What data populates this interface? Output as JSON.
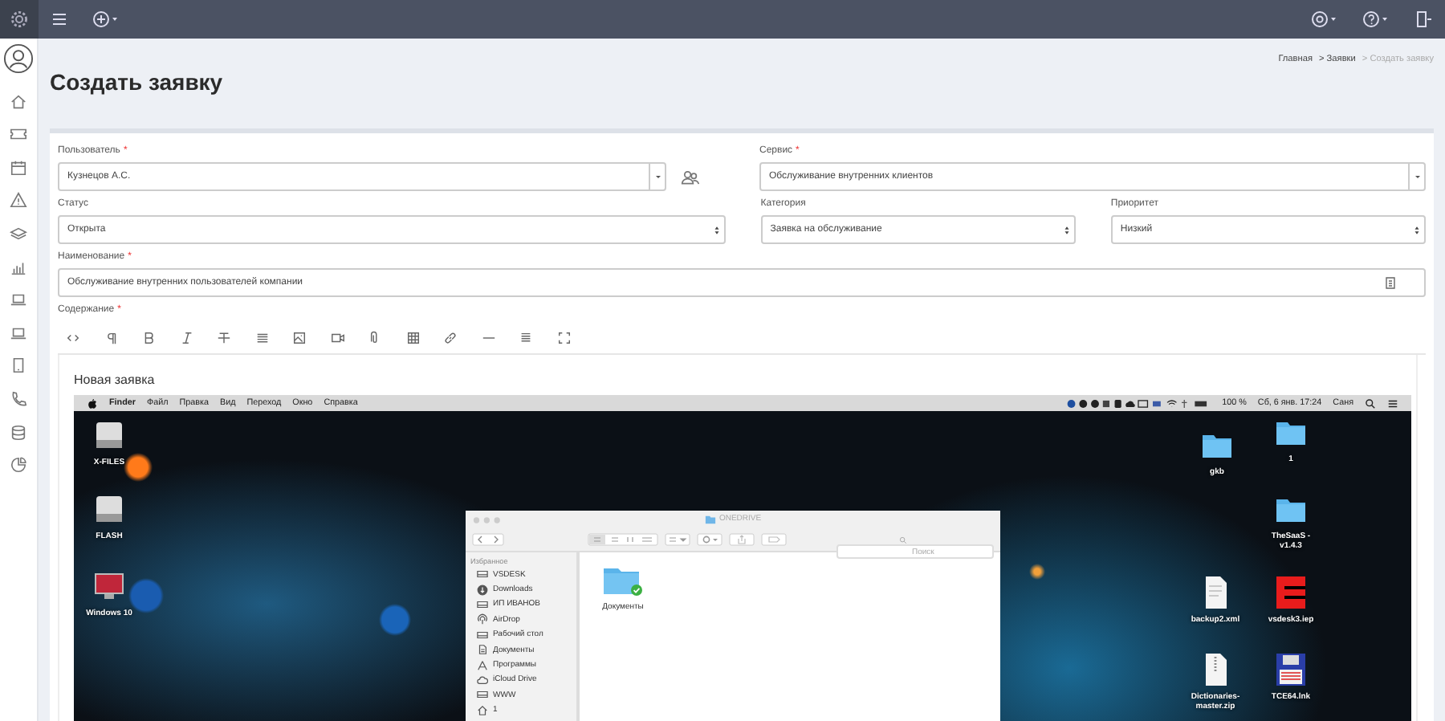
{
  "page_title": "Создать заявку",
  "breadcrumb": [
    {
      "label": "Главная",
      "current": false
    },
    {
      "label": "> Заявки",
      "current": false
    },
    {
      "label": "> Создать заявку",
      "current": true
    }
  ],
  "form_rows": [
    [
      {
        "label": "Пользователь",
        "required_mark": "*",
        "value": "Кузнецов А.С.",
        "kind": "combo",
        "user_picker": true
      },
      {
        "label": "Сервис",
        "required_mark": "*",
        "value": "Обслуживание внутренних клиентов",
        "kind": "combo"
      }
    ],
    [
      {
        "label": "Статус",
        "value": "Открыта",
        "kind": "select"
      },
      {
        "label": "Категория",
        "value": "Заявка на обслуживание",
        "kind": "select"
      },
      {
        "label": "Приоритет",
        "value": "Низкий",
        "kind": "select"
      }
    ],
    [
      {
        "label": "Наименование",
        "required_mark": "*",
        "value": "Обслуживание внутренних пользователей компании",
        "kind": "text"
      }
    ]
  ],
  "editor": {
    "label": "Содержание",
    "required_mark": "*",
    "heading": "Новая заявка",
    "screenshot": {
      "menu_bar": {
        "app": "Finder",
        "menus": [
          "Файл",
          "Правка",
          "Вид",
          "Переход",
          "Окно",
          "Справка"
        ],
        "battery": "100 %",
        "clock": "Сб, 6 янв. 17:24",
        "user": "Саня"
      },
      "desktop_icons": [
        {
          "label": "X-FILES",
          "kind": "drive"
        },
        {
          "label": "FLASH",
          "kind": "drive"
        },
        {
          "label": "Windows 10",
          "kind": "monitor"
        },
        {
          "label": "gkb",
          "kind": "folder"
        },
        {
          "label": "1",
          "kind": "folder"
        },
        {
          "label": "TheSaaS - v1.4.3",
          "kind": "folder"
        },
        {
          "label": "backup2.xml",
          "kind": "document"
        },
        {
          "label": "vsdesk3.iep",
          "kind": "app"
        },
        {
          "label": "Dictionaries-master.zip",
          "kind": "archive"
        },
        {
          "label": "TCE64.lnk",
          "kind": "floppy"
        }
      ],
      "finder": {
        "title": "ONEDRIVE",
        "search": {
          "placeholder": "Поиск"
        },
        "sidebar_heading": "Избранное",
        "sidebar_items": [
          {
            "label": "VSDESK",
            "kind": "drive"
          },
          {
            "label": "Downloads",
            "kind": "download"
          },
          {
            "label": "ИП ИВАНОВ",
            "kind": "drive"
          },
          {
            "label": "AirDrop",
            "kind": "airdrop"
          },
          {
            "label": "Рабочий стол",
            "kind": "drive"
          },
          {
            "label": "Документы",
            "kind": "document"
          },
          {
            "label": "Программы",
            "kind": "apps"
          },
          {
            "label": "iCloud Drive",
            "kind": "cloud"
          },
          {
            "label": "WWW",
            "kind": "drive"
          },
          {
            "label": "1",
            "kind": "home"
          }
        ],
        "files": [
          {
            "label": "Документы",
            "synced": true
          }
        ]
      }
    }
  }
}
